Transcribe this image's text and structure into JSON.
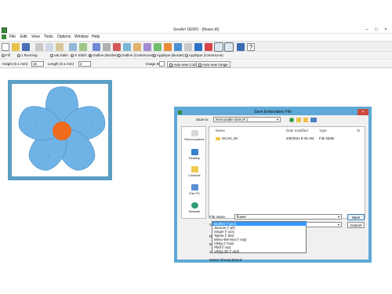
{
  "window": {
    "title": "SewArt DEMO - [flower.tif]"
  },
  "menu": {
    "items": [
      "File",
      "Edit",
      "View",
      "Tools",
      "Options",
      "Window",
      "Help"
    ]
  },
  "modes": {
    "items": [
      {
        "label": "Fill",
        "checked": false
      },
      {
        "label": "1 Running",
        "checked": false
      },
      {
        "label": "Var.Satin",
        "checked": false
      },
      {
        "label": "X-Stitch",
        "checked": false
      },
      {
        "label": "Outline (Border)",
        "checked": true
      },
      {
        "label": "Outline (CentreLine)",
        "checked": false
      },
      {
        "label": "Applique (Border)",
        "checked": false
      },
      {
        "label": "Applique (CentreLine)",
        "checked": false
      }
    ]
  },
  "params": {
    "height_label": "Height (0.1 mm)",
    "height_value": "15",
    "length_label": "Length (0.1 mm)",
    "length_value": "4",
    "image_box_label": "Image Box",
    "auto_new_color_label": "Auto-new Color",
    "auto_new_image_label": "Auto-new Image"
  },
  "colors": {
    "petal": "#6fb3e6",
    "petal_edge": "#4b8fc4",
    "center": "#ee6a1c",
    "frame": "#5b9fc4",
    "dialog_border": "#5ea9d7",
    "selection": "#3399ff"
  },
  "dialog": {
    "title": "Save Embroidery File",
    "save_in_label": "Save in:",
    "save_in_value": "Removable Disk (F:)",
    "places": [
      "Recent places",
      "Desktop",
      "Libraries",
      "This PC",
      "Network"
    ],
    "columns": {
      "name": "Name",
      "date": "Date modified",
      "type": "Type",
      "size": "Si"
    },
    "files": [
      {
        "name": "SCAN_00",
        "date": "2/8/2021 8:45 AM",
        "type": "File folder"
      }
    ],
    "file_name_label": "File name:",
    "file_name_value": "flower",
    "save_as_label": "Save as type:",
    "save_as_value": "Brother (*.pes)",
    "save_button": "Save",
    "cancel_button": "Cancel",
    "option_labels": [
      "Design Scale Factor",
      "Minimum Stitches (n",
      "Join Adjacent Same",
      "Select Thread Brand"
    ],
    "type_options": [
      "Brother (*.pes)",
      "Janome (*.jef)",
      "Singer (*.xxx)",
      "Tajima (*.dst)",
      "Melco-Bernina (*.exp)",
      "Viking (*.hus)",
      "Pfaff (*.vip)",
      "Viking 3D (*.vp3)"
    ],
    "selected_type_index": 0
  }
}
